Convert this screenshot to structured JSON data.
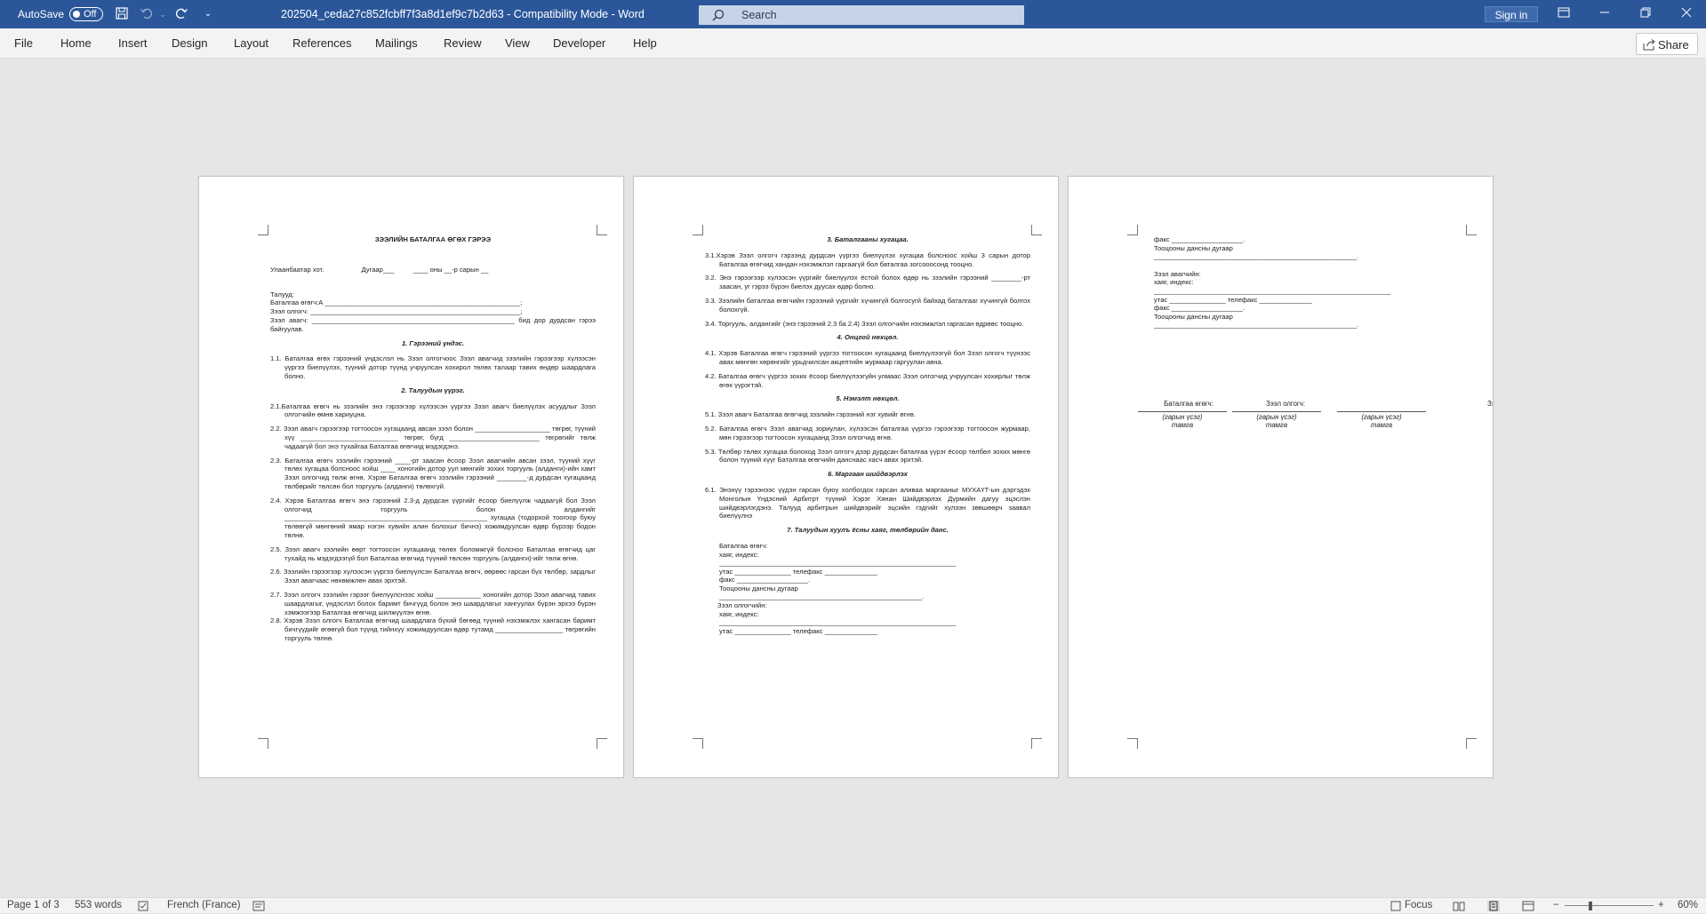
{
  "titlebar": {
    "autosave_label": "AutoSave",
    "autosave_state": "Off",
    "document_title": "202504_ceda27c852fcbff7f3a8d1ef9c7b2d63  -  Compatibility Mode  -  Word",
    "search_placeholder": "Search",
    "signin_label": "Sign in",
    "color": "#2b579a"
  },
  "menubar": {
    "items": [
      "File",
      "Home",
      "Insert",
      "Design",
      "Layout",
      "References",
      "Mailings",
      "Review",
      "View",
      "Developer",
      "Help"
    ],
    "share_label": "Share"
  },
  "pages": {
    "p1": {
      "title": "ЗЭЭЛИЙН БАТАЛГАА ӨГӨХ ГЭРЭЭ",
      "place_line": "Улаанбаатар хот.                    Дугаар___          ____ оны __-р сарын __",
      "parties_heading": "Талууд:",
      "parties": [
        "Баталгаа өгөгч:А ____________________________________________________;",
        "Зээл олгогч: ________________________________________________________;",
        "Зээл  авагч:  ______________________________________________________  бид  дор дурдсан гэрээ байгуулав."
      ],
      "sections": [
        {
          "heading": "1. Гэрээний үндэс.",
          "items": [
            "1.1.  Баталгаа өгөх гэрээний үндэслэл нь Зээл олгогчоос Зээл авагчид зээлийн гэрээгээр хүлээсэн үүргээ биелүүлэх, түүний дотор түүнд учруулсан хохирол төлөх талаар тавих өндөр шаардлага болно."
          ]
        },
        {
          "heading": "2. Талуудын үүрэг.",
          "items": [
            "2.1.Баталгаа өгөгч нь зээлийн энэ гэрээгээр хүлээсэн үүргээ Зээл авагч биелүүлэх асуудлыг Зээл олгогчийн өмнө хариуцна.",
            "2.2.  Зээл авагч гэрээгээр тогтоосон хугацаанд авсан зээл болон ____________________ төгрөг, түүний хүү __________________________ төгрөг, бүгд ________________________ төгрөгийг төлж чадаагүй бол энэ тухайгаа Баталгаа өгөгчид мэдэгдэнэ.",
            "2.3. Баталгаа өгөгч зээлийн гэрээний ____-рт заасан ёсоор Зээл авагчийн авсан зээл, түүний хүүг төлөх хугацаа болсноос хойш ____ хоногийн дотор уул мөнгийг зохих торгууль (алданги)-ийн хамт Зээл олгогчид төлж өгнө. Хэрэв Баталгаа өгөгч зээлийн гэрээний ________-д дурдсан хугацаанд төлбөрийг төлсөн бол торгууль (алданги) төлөхгүй.",
            "2.4.  Хэрэв Баталгаа өгөгч энэ гэрээний 2.3-д дурдсан үүргийг ёсоор биелүүлж чадаагүй бол Зээл олгогчид торгууль болон алдангийг ______________________________________________________ хугацаа (тодорхой тоогоор буюу төлөөгүй мөнгөний ямар нэгэн хувийн алин болохыг бичнэ) хожимдуулсан өдөр бүрээр бодон төлнө.",
            "2.5. Зээл авагч зээлийн өөрт тогтоосон хугацаанд төлөх боломжгүй болсноо Баталгаа өгөгчид цаг тухайд нь мэдэгдээгүй бол Баталгаа өгөгчид түүний төлсөн торгууль (алданги)-ийг төлж өгнө.",
            "2.6. Зээлийн гэрээгээр хүлээсэн үүргээ биелүүлсэн Баталгаа өгөгч, өөрөөс гарсан бүх төлбөр, зардлыг Зээл авагчаас нөхөмжлөн авах эрхтэй.",
            "2.7.  Зээл олгогч зээлийн гэрээг биелүүлснээс хойш ____________ хоногийн дотор Зээл авагчид тавих шаардлагыг, үндэслэл болох баримт бичгүүд болон энэ шаардлагыг хангуулах бүрэн эрхээ бүрэн хэмжээгээр Баталгаа өгөгчид шилжүүлэн өгнө.",
            "2.8.  Хэрэв Зээл олгогч Баталгаа өгөгчид шаардлага бүхий бөгөөд түүний нэхэмжлэх хангасан баримт бичгүүдийг өгөөгүй бол түүнд тийнхүү хожимдуулсан өдөр тутамд __________________ төгрөгийн торгууль төлнө."
          ]
        }
      ]
    },
    "p2": {
      "sections": [
        {
          "heading": "3. Баталгааны хугацаа.",
          "items": [
            "3.1.Хэрэв Зээл олгогч гэрээнд дурдсан үүргээ биелүүлэх хугацаа болсноос хойш 3 сарын дотор Баталгаа өгөгчид хандан нэхэмжлэл гаргаагүй бол баталгаа зогсооосонд тооцно.",
            "3.2. Энэ гэрээгээр хүлээсэн үүргийг биелүүлэх ёстой болох өдөр нь зээлийн гэрээний ________-рт заасан, уг гэрээ бүрэн биелэх дуусах өдөр болно.",
            "3.3. Зээлийн баталгаа өгөгчийн  гэрээний үүргийг хүчингүй болгосугй байхад баталгааг хүчингүй болгох болохгүй.",
            "3.4. Торгууль, алдангийг (энэ гэрээний 2.3 ба 2.4) Зээл олгогчийн нэхэмжлэл гаргасан өдрөөс тооцно."
          ]
        },
        {
          "heading": "4. Онцгой нөхцөл.",
          "items": [
            "4.1.  Хэрэв  Баталгаа өгөгч  гэрээний үүргээ тогтоосон хугацаанд биелүүлээгүй бол Зээл олгогч түүнээс авах мөнгөн хөрөнгийг урьдчилсан акцептийн журмаар гаргуулан авна.",
            "4.2. Баталгаа өгөгч үүргээ зохих ёсоор биелүүлээгүйн улмаас Зээл олгогчид учруулсан хохирлыг төлж өгөх үүрэгтэй."
          ]
        },
        {
          "heading": "5. Нэмэлт нөхцөл.",
          "items": [
            "5.1. Зээл авагч Баталгаа өгөгчид зээлийн гэрээний нэг хувийг өгнө.",
            "5.2.  Баталгаа өгөгч Зээл авагчид зориулан, хүлээсэн баталгаа үүргээ гэрээгээр тогтоосон журмаар, мөн гэрээгээр тогтоосон хугацаанд Зээл олгогчид өгнө.",
            "5.3.  Төлбөр төлөх хугацаа болоход Зээл олгогч дээр дурдсан баталгаа үүрэг ёсоор төлбөл зохих мөнгө болон түүний хүүг Баталгаа өгөгчийн данснаас хасч авах эрхтэй."
          ]
        },
        {
          "heading": "6. Маргаан шийдвэрлэх",
          "items": [
            "6.1.  Энэхүү гэрээнээс үүдэн гарсан буюу холбогдох гарсан аливаа маргааныг МУХАҮТ-ын дэргэдэх Монголын Үндэсний Арбитрт түүний Хэрэг Хянан Шийдвэрлэх Дүрмийн дагуу эцэслэн шийдвэрлэгдэнэ. Талууд арбитрын шийдвэрийг эцсийн гэдгийг хүлээн зөвшөөрч заавал биелүүлнэ"
          ]
        },
        {
          "heading": "7. Талуудын хуулъ ёсны хаяг, төлбөрийн данс.",
          "items": []
        }
      ],
      "guarantor_lines": [
        "Баталгаа өгөгч:",
        "хаяг, индекс:",
        "_______________________________________________________________",
        "утас _______________ телефакс ______________",
        "факс ___________________.",
        "Тооцооны дансны дугаар",
        "______________________________________________________."
      ],
      "lender_lines": [
        "Зээл олгогчийн:",
        "хаяг, индекс:",
        "_______________________________________________________________",
        "утас _______________ телефакс ______________"
      ]
    },
    "p3": {
      "lender_tail": [
        "факс ___________________.",
        "Тооцооны дансны дугаар",
        "______________________________________________________."
      ],
      "borrower_lines": [
        "Зээл авагчийн:",
        "хаяг, индекс:",
        "_______________________________________________________________",
        "утас _______________ телефакс ______________",
        "факс ___________________.",
        "Тооцооны дансны дугаар",
        "______________________________________________________."
      ],
      "signatures": [
        {
          "role": "Баталгаа өгөгч:",
          "sign": "(гарын үсэг)",
          "seal": "тамга"
        },
        {
          "role": "Зээл олгогч:",
          "sign": "(гарын үсэг)",
          "seal": "тамга"
        },
        {
          "role": "Зээл авагч:",
          "sign": "(гарын үсэг)",
          "seal": "тамга"
        }
      ]
    }
  },
  "statusbar": {
    "page": "Page 1 of 3",
    "words": "553 words",
    "language": "French (France)",
    "focus": "Focus",
    "zoom_minus": "−",
    "zoom_plus": "+",
    "zoom": "60%"
  }
}
